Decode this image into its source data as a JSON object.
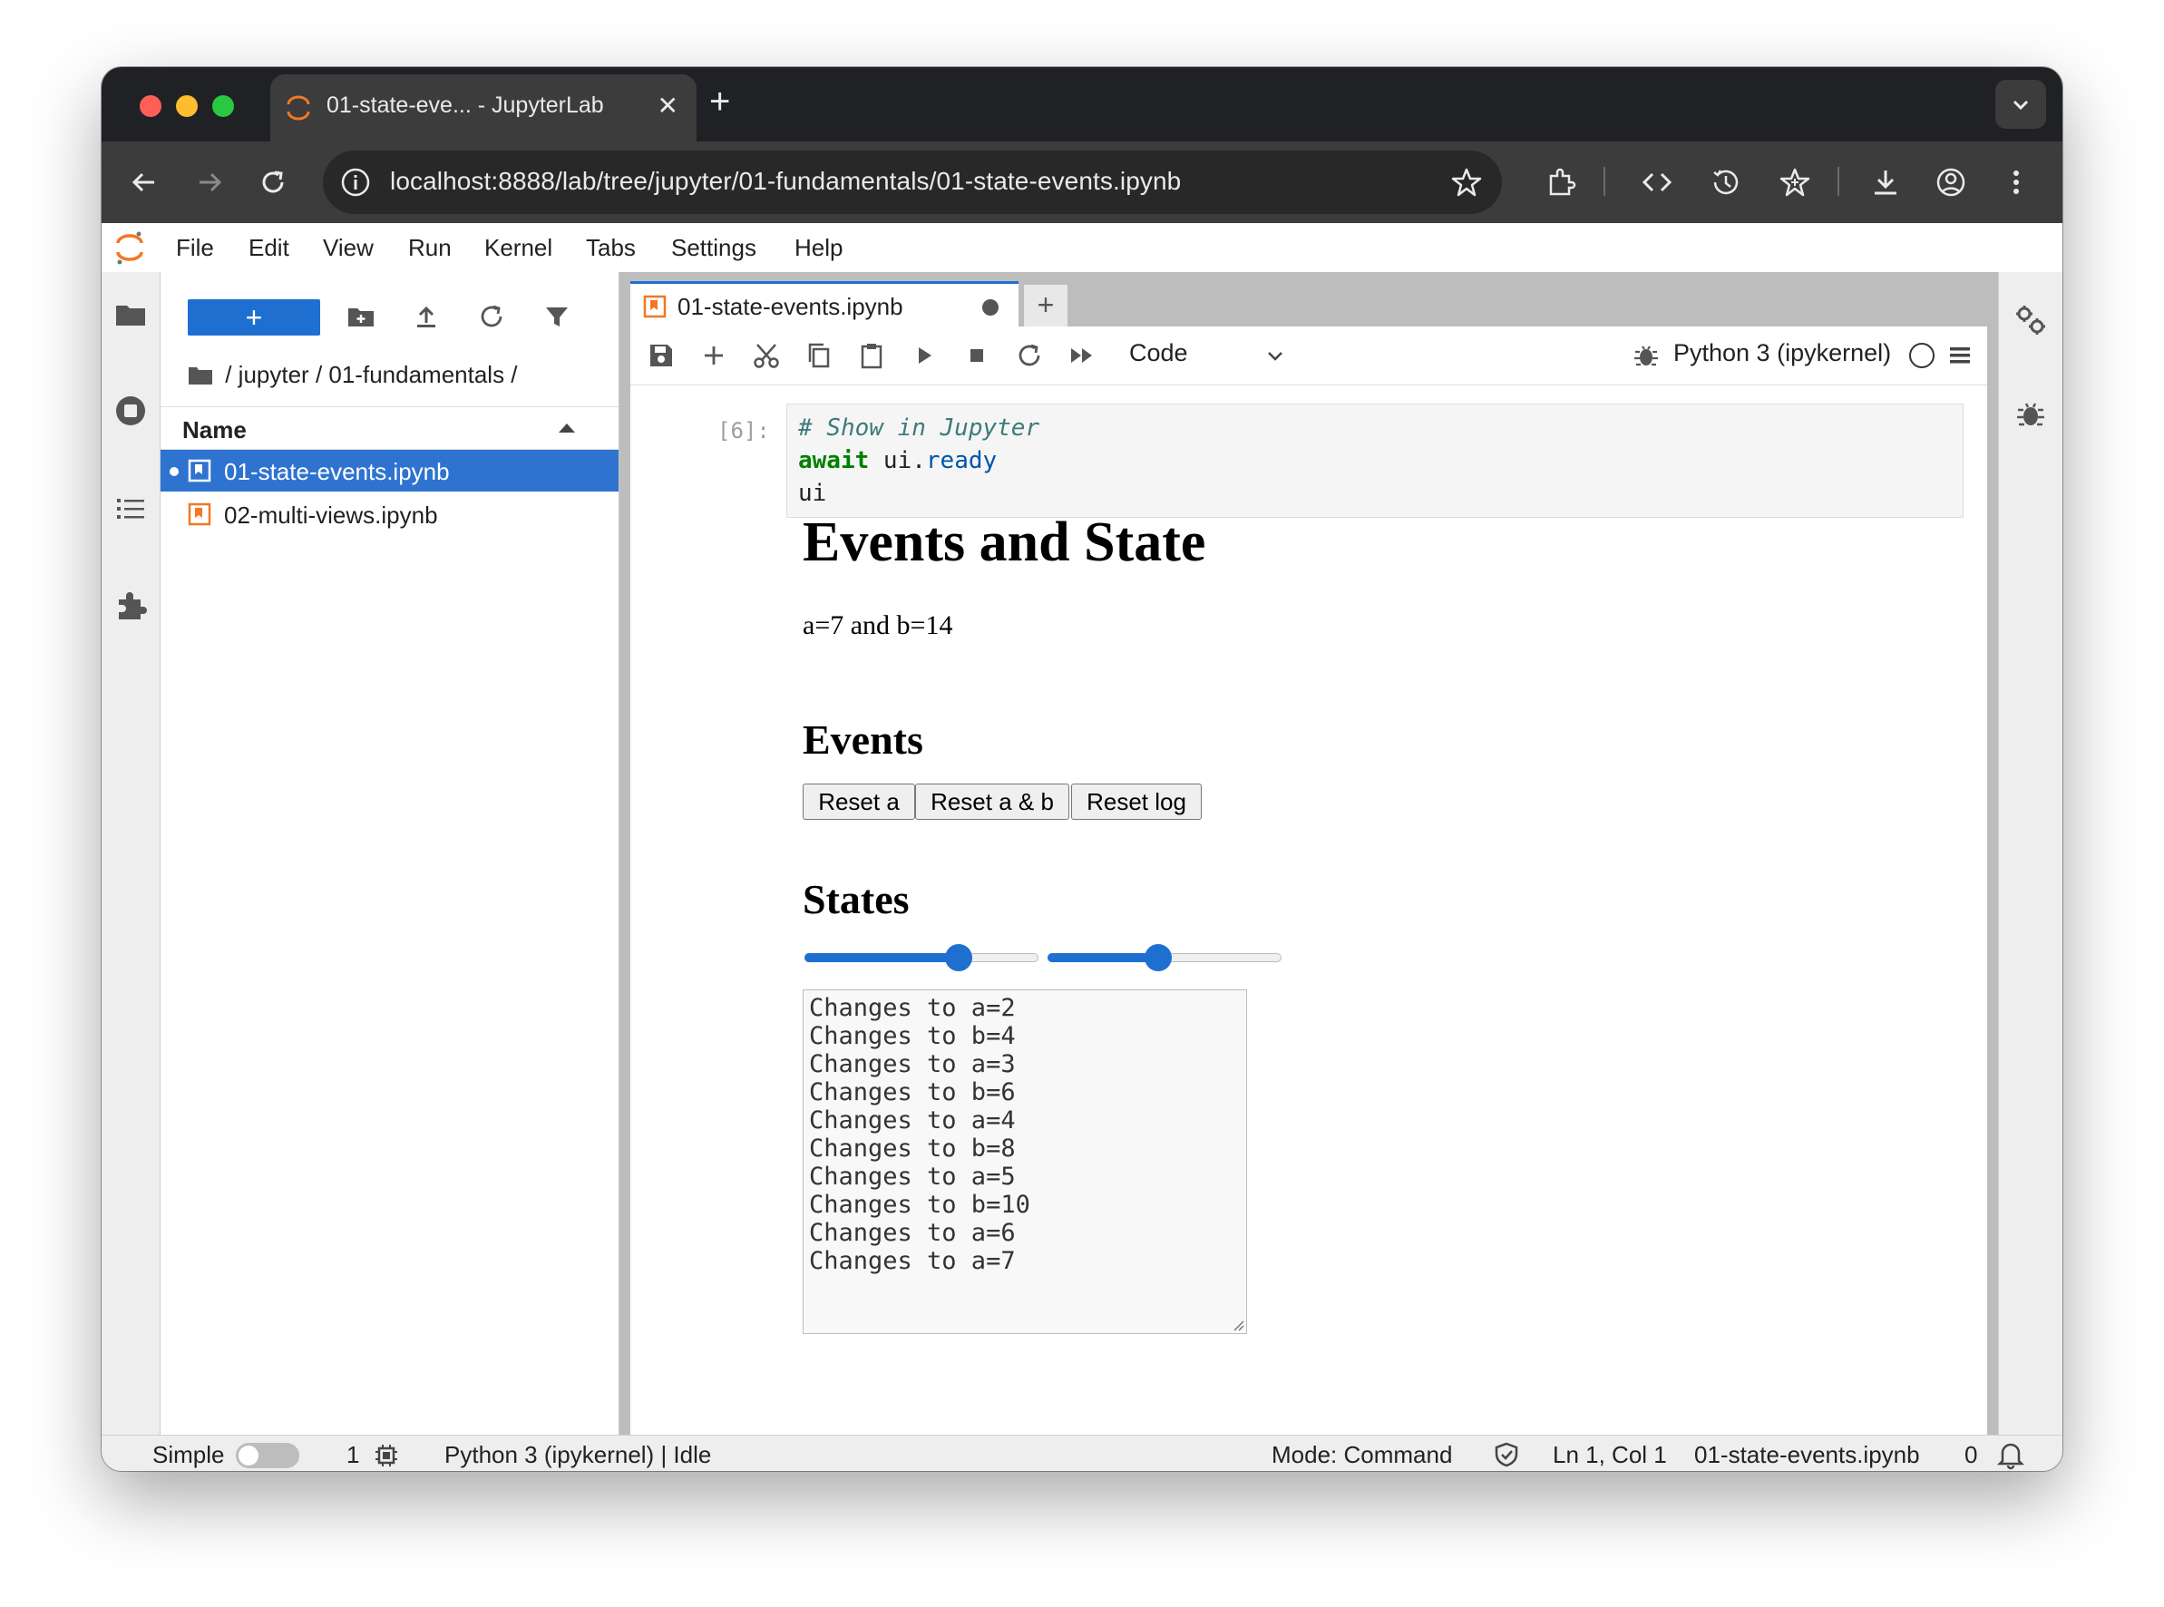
{
  "browser": {
    "tab_title": "01-state-eve... - JupyterLab",
    "url": "localhost:8888/lab/tree/jupyter/01-fundamentals/01-state-events.ipynb",
    "close_glyph": "✕",
    "newtab_glyph": "+"
  },
  "menu": [
    "File",
    "Edit",
    "View",
    "Run",
    "Kernel",
    "Tabs",
    "Settings",
    "Help"
  ],
  "filebrowser": {
    "new_label": "+",
    "breadcrumb": "/ jupyter / 01-fundamentals /",
    "column_name": "Name",
    "files": [
      {
        "name": "01-state-events.ipynb",
        "selected": true,
        "running": true
      },
      {
        "name": "02-multi-views.ipynb",
        "selected": false,
        "running": false
      }
    ]
  },
  "notebook": {
    "tab_title": "01-state-events.ipynb",
    "add_tab": "+",
    "cell_type": "Code",
    "kernel": "Python 3 (ipykernel)",
    "prompt": "[6]:",
    "code": {
      "line1": "# Show in Jupyter",
      "line2_kw": "await",
      "line2_obj": " ui.",
      "line2_attr": "ready",
      "line3": "ui"
    },
    "output": {
      "title": "Events and State",
      "summary": "a=7 and b=14",
      "events_heading": "Events",
      "buttons": [
        "Reset a",
        "Reset a & b",
        "Reset log"
      ],
      "states_heading": "States",
      "slider_a": {
        "value_fraction": 0.68
      },
      "slider_b": {
        "value_fraction": 0.47
      },
      "log": [
        "Changes to a=2",
        "Changes to b=4",
        "Changes to a=3",
        "Changes to b=6",
        "Changes to a=4",
        "Changes to b=8",
        "Changes to a=5",
        "Changes to b=10",
        "Changes to a=6",
        "Changes to a=7"
      ]
    }
  },
  "status": {
    "simple_label": "Simple",
    "terminals": "1",
    "kernel_status": "Python 3 (ipykernel) | Idle",
    "mode": "Mode: Command",
    "position": "Ln 1, Col 1",
    "filename": "01-state-events.ipynb",
    "notifications": "0"
  },
  "colors": {
    "accent": "#1f6fd1",
    "jupyter_orange": "#f37726",
    "chrome_dark": "#202124"
  }
}
